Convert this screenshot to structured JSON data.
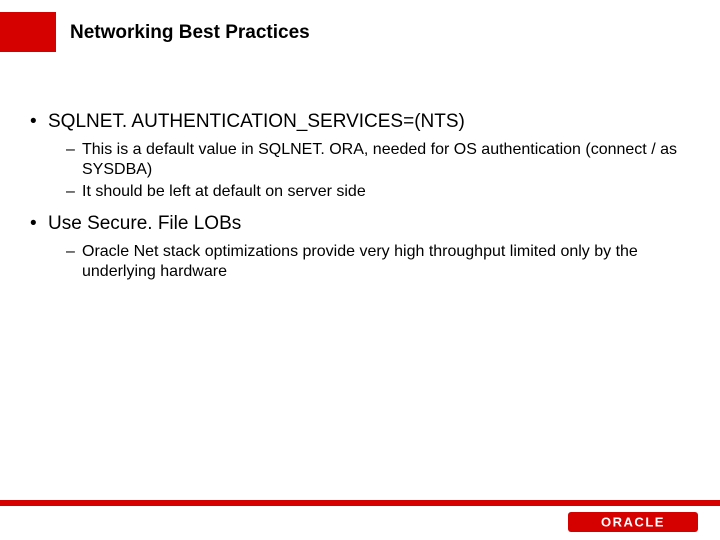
{
  "title": "Networking Best Practices",
  "bullets": {
    "b1a": "SQLNET. AUTHENTICATION_SERVICES=(NTS)",
    "b1a_s1": "This is a default value in SQLNET. ORA, needed for OS authentication (connect / as SYSDBA)",
    "b1a_s2": "It should be left at default on server side",
    "b1b": "Use Secure. File LOBs",
    "b1b_s1": "Oracle Net stack optimizations provide very high throughput limited only by the underlying hardware"
  },
  "brand": "ORACLE"
}
